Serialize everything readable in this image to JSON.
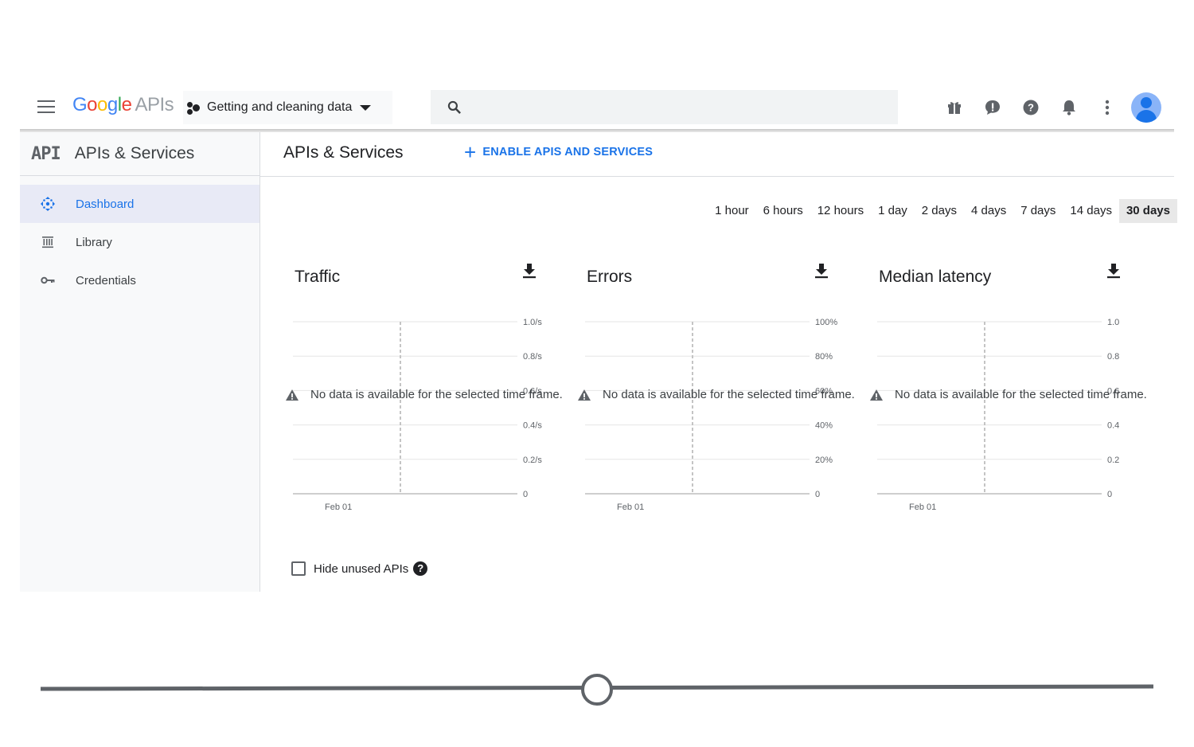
{
  "topbar": {
    "logo_google": [
      "G",
      "o",
      "o",
      "g",
      "l",
      "e"
    ],
    "logo_apis": "APIs",
    "project_name": "Getting and cleaning data",
    "search_placeholder": "",
    "icons": [
      "menu-icon",
      "gift-icon",
      "feedback-icon",
      "help-icon",
      "notifications-icon",
      "more-vert-icon",
      "account-avatar"
    ]
  },
  "sidebar": {
    "logo_text": "API",
    "title": "APIs & Services",
    "items": [
      {
        "label": "Dashboard",
        "icon": "dashboard-icon",
        "active": true
      },
      {
        "label": "Library",
        "icon": "library-icon",
        "active": false
      },
      {
        "label": "Credentials",
        "icon": "key-icon",
        "active": false
      }
    ]
  },
  "main": {
    "title": "APIs & Services",
    "enable_button": "ENABLE APIS AND SERVICES",
    "time_ranges": [
      "1 hour",
      "6 hours",
      "12 hours",
      "1 day",
      "2 days",
      "4 days",
      "7 days",
      "14 days",
      "30 days"
    ],
    "selected_range": "30 days",
    "hide_unused_label": "Hide unused APIs"
  },
  "chart_data": [
    {
      "type": "line",
      "title": "Traffic",
      "y_ticks": [
        "1.0/s",
        "0.8/s",
        "0.6/s",
        "0.4/s",
        "0.2/s",
        "0"
      ],
      "x_ticks": [
        "Feb 01"
      ],
      "series": [],
      "no_data_message": "No data is available for the selected time frame."
    },
    {
      "type": "line",
      "title": "Errors",
      "y_ticks": [
        "100%",
        "80%",
        "60%",
        "40%",
        "20%",
        "0"
      ],
      "x_ticks": [
        "Feb 01"
      ],
      "series": [],
      "no_data_message": "No data is available for the selected time frame."
    },
    {
      "type": "line",
      "title": "Median latency",
      "y_ticks": [
        "1.0",
        "0.8",
        "0.6",
        "0.4",
        "0.2",
        "0"
      ],
      "x_ticks": [
        "Feb 01"
      ],
      "series": [],
      "no_data_message": "No data is available for the selected time frame."
    }
  ],
  "colors": {
    "accent": "#1a73e8",
    "sidebar_bg": "#f8f9fa",
    "active_nav_bg": "#e8eaf6"
  },
  "timeline": {
    "position": 0.5
  }
}
